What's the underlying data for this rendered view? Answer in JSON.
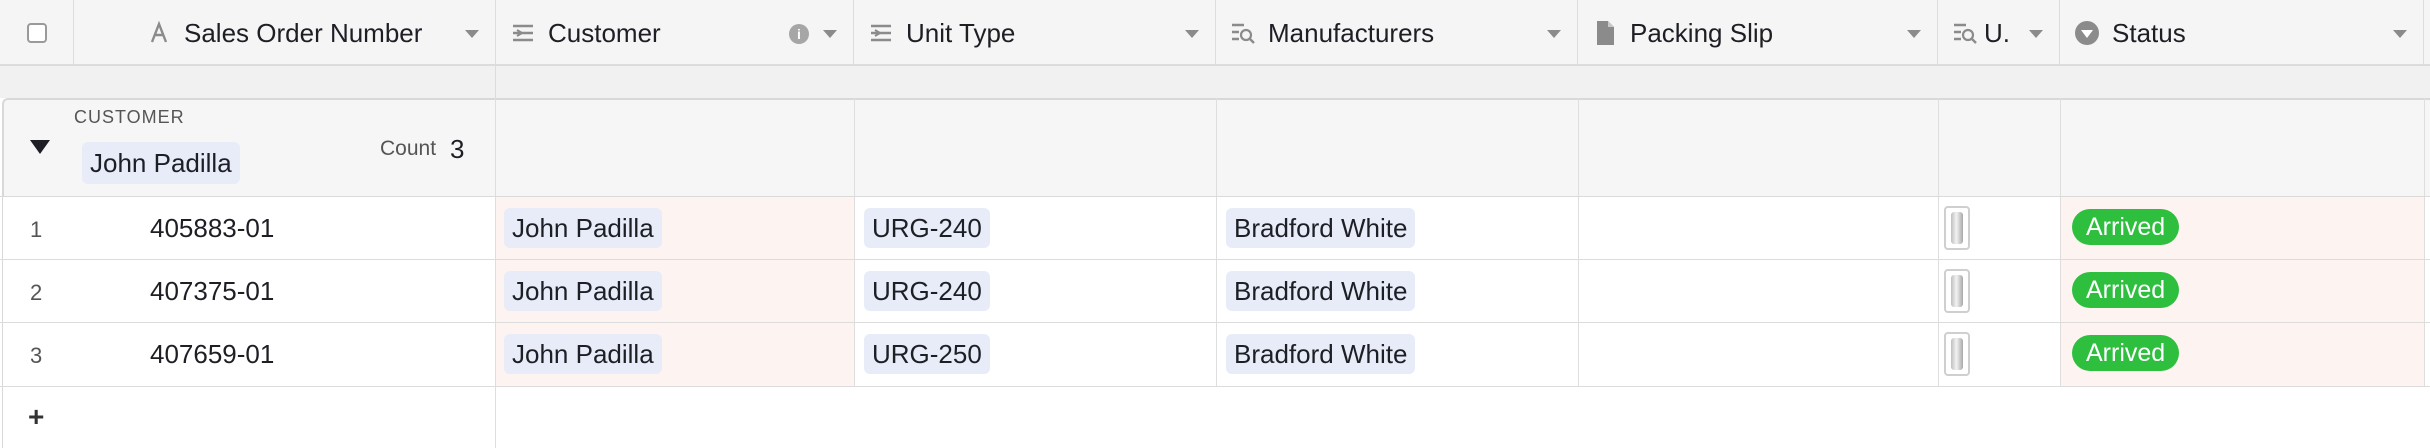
{
  "columns": [
    {
      "label": "Sales Order Number",
      "icon": "text-field-icon"
    },
    {
      "label": "Customer",
      "icon": "link-field-icon",
      "info_icon": "info-icon"
    },
    {
      "label": "Unit Type",
      "icon": "link-field-icon"
    },
    {
      "label": "Manufacturers",
      "icon": "lookup-field-icon"
    },
    {
      "label": "Packing Slip",
      "icon": "attachment-field-icon"
    },
    {
      "label": "U.",
      "icon": "lookup-field-icon"
    },
    {
      "label": "Status",
      "icon": "single-select-field-icon"
    }
  ],
  "group": {
    "field_label": "CUSTOMER",
    "value": "John Padilla",
    "count_label": "Count",
    "count": "3"
  },
  "rows": [
    {
      "num": "1",
      "order": "405883-01",
      "customer": "John Padilla",
      "unit_type": "URG-240",
      "manufacturer": "Bradford White",
      "status": "Arrived"
    },
    {
      "num": "2",
      "order": "407375-01",
      "customer": "John Padilla",
      "unit_type": "URG-240",
      "manufacturer": "Bradford White",
      "status": "Arrived"
    },
    {
      "num": "3",
      "order": "407659-01",
      "customer": "John Padilla",
      "unit_type": "URG-250",
      "manufacturer": "Bradford White",
      "status": "Arrived"
    }
  ],
  "add_row_label": "+",
  "colors": {
    "status_arrived": "#2fbf3f",
    "pill_bg": "#e7ecf8",
    "customer_tint": "#fdf3f1"
  }
}
